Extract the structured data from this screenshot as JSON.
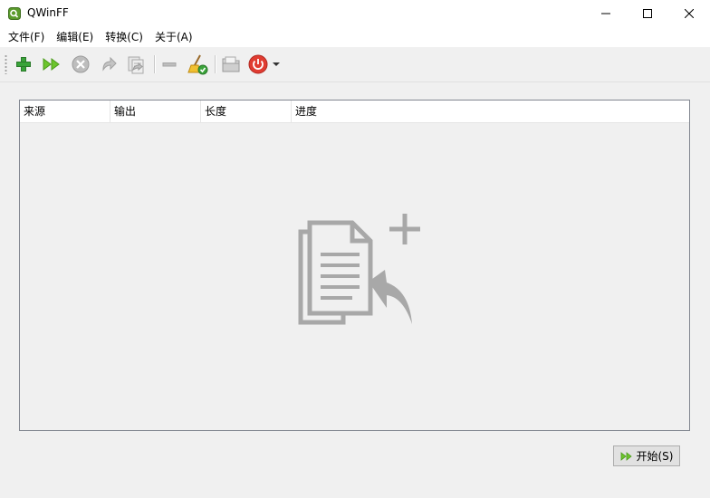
{
  "window": {
    "title": "QWinFF",
    "icon": "qwinff-app-icon"
  },
  "menu": {
    "items": [
      "文件(F)",
      "编辑(E)",
      "转换(C)",
      "关于(A)"
    ]
  },
  "toolbar": {
    "buttons": [
      {
        "name": "add-file",
        "icon": "plus-icon",
        "color": "#3aa33a"
      },
      {
        "name": "start-conversion",
        "icon": "double-play-icon",
        "color": "#6cc42c"
      },
      {
        "name": "stop-conversion",
        "icon": "stop-x-icon",
        "color": "#a8a8a8"
      },
      {
        "name": "retry",
        "icon": "redo-icon",
        "color": "#b0b0b0"
      },
      {
        "name": "retry-all",
        "icon": "redo-all-icon",
        "color": "#b0b0b0"
      },
      {
        "name": "remove",
        "icon": "minus-icon",
        "color": "#b0b0b0"
      },
      {
        "name": "clear-list",
        "icon": "broom-check-icon",
        "color": "#e0b020"
      },
      {
        "name": "open-output-folder",
        "icon": "folder-icon",
        "color": "#a8a8a8"
      },
      {
        "name": "power-off",
        "icon": "power-icon",
        "color": "#e03c31"
      }
    ]
  },
  "table": {
    "columns": [
      "来源",
      "输出",
      "长度",
      "进度"
    ],
    "rows": [],
    "empty_icon": "add-files-document-icon"
  },
  "start_button": {
    "label": "开始(S)",
    "icon": "double-play-icon"
  },
  "colors": {
    "accent_green": "#6cc42c",
    "power_red": "#e03c31",
    "empty_icon_gray": "#a8a8a8"
  }
}
